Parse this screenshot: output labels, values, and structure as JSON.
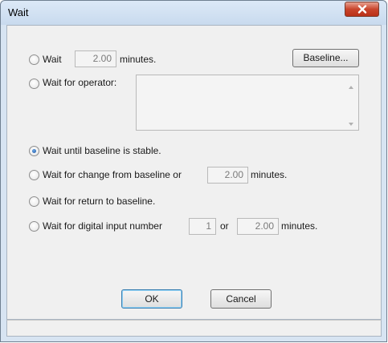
{
  "window": {
    "title": "Wait"
  },
  "options": {
    "wait": {
      "label_pre": "Wait",
      "value": "2.00",
      "label_post": "minutes."
    },
    "operator": {
      "label": "Wait for operator:",
      "text": ""
    },
    "stable": {
      "label": "Wait until baseline is stable.",
      "checked": true
    },
    "change": {
      "label": "Wait for change from baseline or",
      "value": "2.00",
      "label_post": "minutes."
    },
    "return": {
      "label": "Wait for return to baseline."
    },
    "digital": {
      "label": "Wait for digital input number",
      "input_number": "1",
      "or_label": "or",
      "value": "2.00",
      "label_post": "minutes."
    }
  },
  "buttons": {
    "baseline": "Baseline...",
    "ok": "OK",
    "cancel": "Cancel"
  },
  "icons": {
    "close": "close-icon",
    "scroll_up": "scroll-up-arrow-icon",
    "scroll_down": "scroll-down-arrow-icon"
  }
}
